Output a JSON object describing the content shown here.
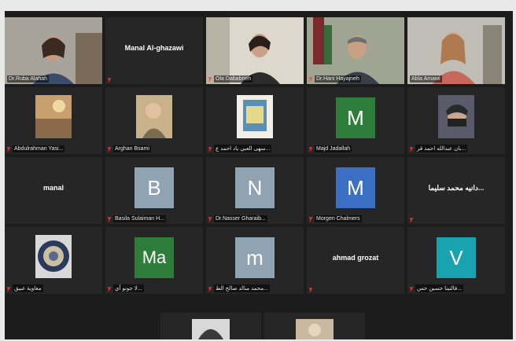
{
  "participants": [
    {
      "name": "Dr.Ruba Alahah",
      "type": "video",
      "muted": false
    },
    {
      "name": "",
      "center": "Manal Al-ghazawi",
      "type": "name",
      "muted": true
    },
    {
      "name": "Ola Dababneh",
      "type": "video",
      "muted": true
    },
    {
      "name": "Dr.Hani Hayajneh",
      "type": "video",
      "muted": true
    },
    {
      "name": "Abla Amawi",
      "type": "video",
      "muted": false,
      "active": true
    },
    {
      "name": "Abdulrahman Yasi...",
      "type": "photo",
      "muted": true
    },
    {
      "name": "Arghan Bsami",
      "type": "photo",
      "muted": true
    },
    {
      "name": "سهى العبي ياد احمد ع...",
      "type": "photo",
      "muted": true
    },
    {
      "name": "Majd Jadallah",
      "type": "avatar",
      "letter": "M",
      "color": "#2f7d3a",
      "muted": true
    },
    {
      "name": "بان عبدالله احمد قر...",
      "type": "photo",
      "muted": true
    },
    {
      "name": "",
      "center": "manal",
      "type": "name",
      "muted": false
    },
    {
      "name": "Basila Sulaiman H...",
      "type": "avatar",
      "letter": "B",
      "color": "#8fa3b3",
      "muted": true
    },
    {
      "name": "Dr.Nasser Gharaib...",
      "type": "avatar",
      "letter": "N",
      "color": "#8fa3b3",
      "muted": true
    },
    {
      "name": "Morgen Chalmers",
      "type": "avatar",
      "letter": "M",
      "color": "#3a6fc4",
      "muted": true
    },
    {
      "name": "",
      "center": "دانيه محمد سليما...",
      "type": "name",
      "muted": true
    },
    {
      "name": "معاوية عبيق",
      "type": "photo",
      "muted": true
    },
    {
      "name": "لا جونو أي...",
      "type": "avatar",
      "letter": "Ma",
      "color": "#2f7d3a",
      "muted": true
    },
    {
      "name": "محمد منالد صالح الط...",
      "type": "avatar",
      "letter": "m",
      "color": "#8fa3b3",
      "muted": true
    },
    {
      "name": "",
      "center": "ahmad grozat",
      "type": "name",
      "muted": true
    },
    {
      "name": "فالتينا حسين حس...",
      "type": "avatar",
      "letter": "V",
      "color": "#19a3b0",
      "muted": true
    }
  ]
}
